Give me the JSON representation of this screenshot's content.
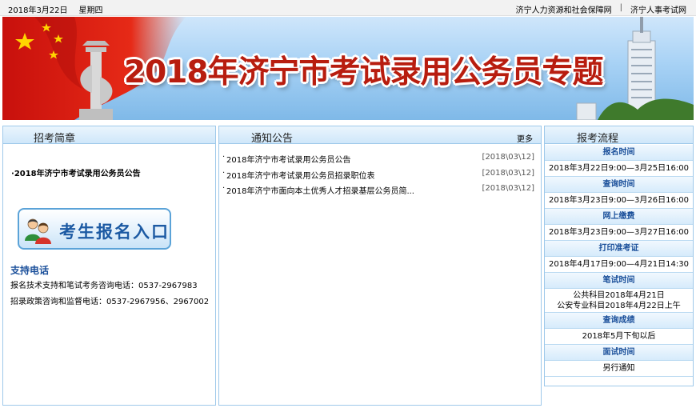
{
  "topbar": {
    "date": "2018年3月22日",
    "weekday": "星期四",
    "link1": "济宁人力资源和社会保障网",
    "separator": "|",
    "link2": "济宁人事考试网"
  },
  "banner": {
    "title": "2018年济宁市考试录用公务员专题"
  },
  "left": {
    "heading": "招考简章",
    "notice_bullet": "·",
    "notice": "2018年济宁市考试录用公务员公告",
    "register_button": "考生报名入口",
    "support_title": "支持电话",
    "support_line1": "报名技术支持和笔试考务咨询电话：0537-2967983",
    "support_line2": "招录政策咨询和监督电话：0537-2967956、2967002"
  },
  "middle": {
    "heading": "通知公告",
    "more": "更多",
    "items": [
      {
        "bullet": "·",
        "title": "2018年济宁市考试录用公务员公告",
        "date": "[2018\\03\\12]"
      },
      {
        "bullet": "·",
        "title": "2018年济宁市考试录用公务员招录职位表",
        "date": "[2018\\03\\12]"
      },
      {
        "bullet": "·",
        "title": "2018年济宁市面向本土优秀人才招录基层公务员简...",
        "date": "[2018\\03\\12]"
      }
    ]
  },
  "right": {
    "heading": "报考流程",
    "steps": [
      {
        "title": "报名时间",
        "value": "2018年3月22日9:00—3月25日16:00"
      },
      {
        "title": "查询时间",
        "value": "2018年3月23日9:00—3月26日16:00"
      },
      {
        "title": "网上缴费",
        "value": "2018年3月23日9:00—3月27日16:00"
      },
      {
        "title": "打印准考证",
        "value": "2018年4月17日9:00—4月21日14:30"
      },
      {
        "title": "笔试时间",
        "value": "公共科目2018年4月21日",
        "value2": "公安专业科目2018年4月22日上午"
      },
      {
        "title": "查询成绩",
        "value": "2018年5月下旬以后"
      },
      {
        "title": "面试时间",
        "value": "另行通知"
      }
    ]
  },
  "colors": {
    "accent_blue": "#1a4f9a",
    "border_blue": "#9fc9ea",
    "title_red": "#b81d0f"
  }
}
